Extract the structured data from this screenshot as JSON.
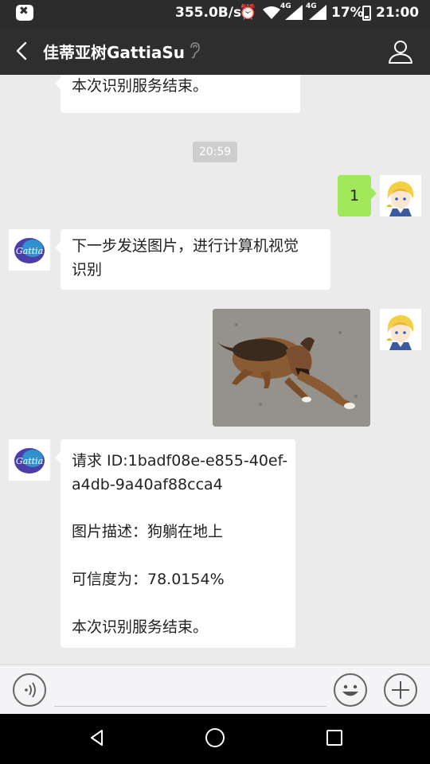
{
  "status_bar": {
    "speed": "355.0B/s",
    "network_tag_1": "4G",
    "network_tag_2": "4G",
    "battery": "17%",
    "time": "21:00"
  },
  "header": {
    "title": "佳蒂亚树GattiaSu"
  },
  "messages": {
    "top_partial": "本次识别服务结束。",
    "timestamp": "20:59",
    "sent_text": "1",
    "bot_text_1_line1": "下一步发送图片，进行计算机视觉",
    "bot_text_1_line2": "识别",
    "bot_logo_text": "Gattia",
    "result_line1": "请求 ID:1badf08e-e855-40ef-",
    "result_line2": "a4db-9a40af88cca4",
    "result_desc": "图片描述：狗躺在地上",
    "result_confidence": "可信度为：78.0154%",
    "result_end": "本次识别服务结束。"
  },
  "icons": {
    "status_left": "notification-icon",
    "alarm": "alarm-icon",
    "wifi": "wifi-icon",
    "back": "back-arrow-icon",
    "ear": "earpiece-icon",
    "profile": "person-icon",
    "voice": "voice-icon",
    "emoji": "emoji-icon",
    "more": "plus-icon"
  },
  "colors": {
    "sent_bubble": "#a0e75a",
    "received_bubble": "#ffffff",
    "chat_background": "#ebebeb",
    "header": "#2e2e2e"
  }
}
